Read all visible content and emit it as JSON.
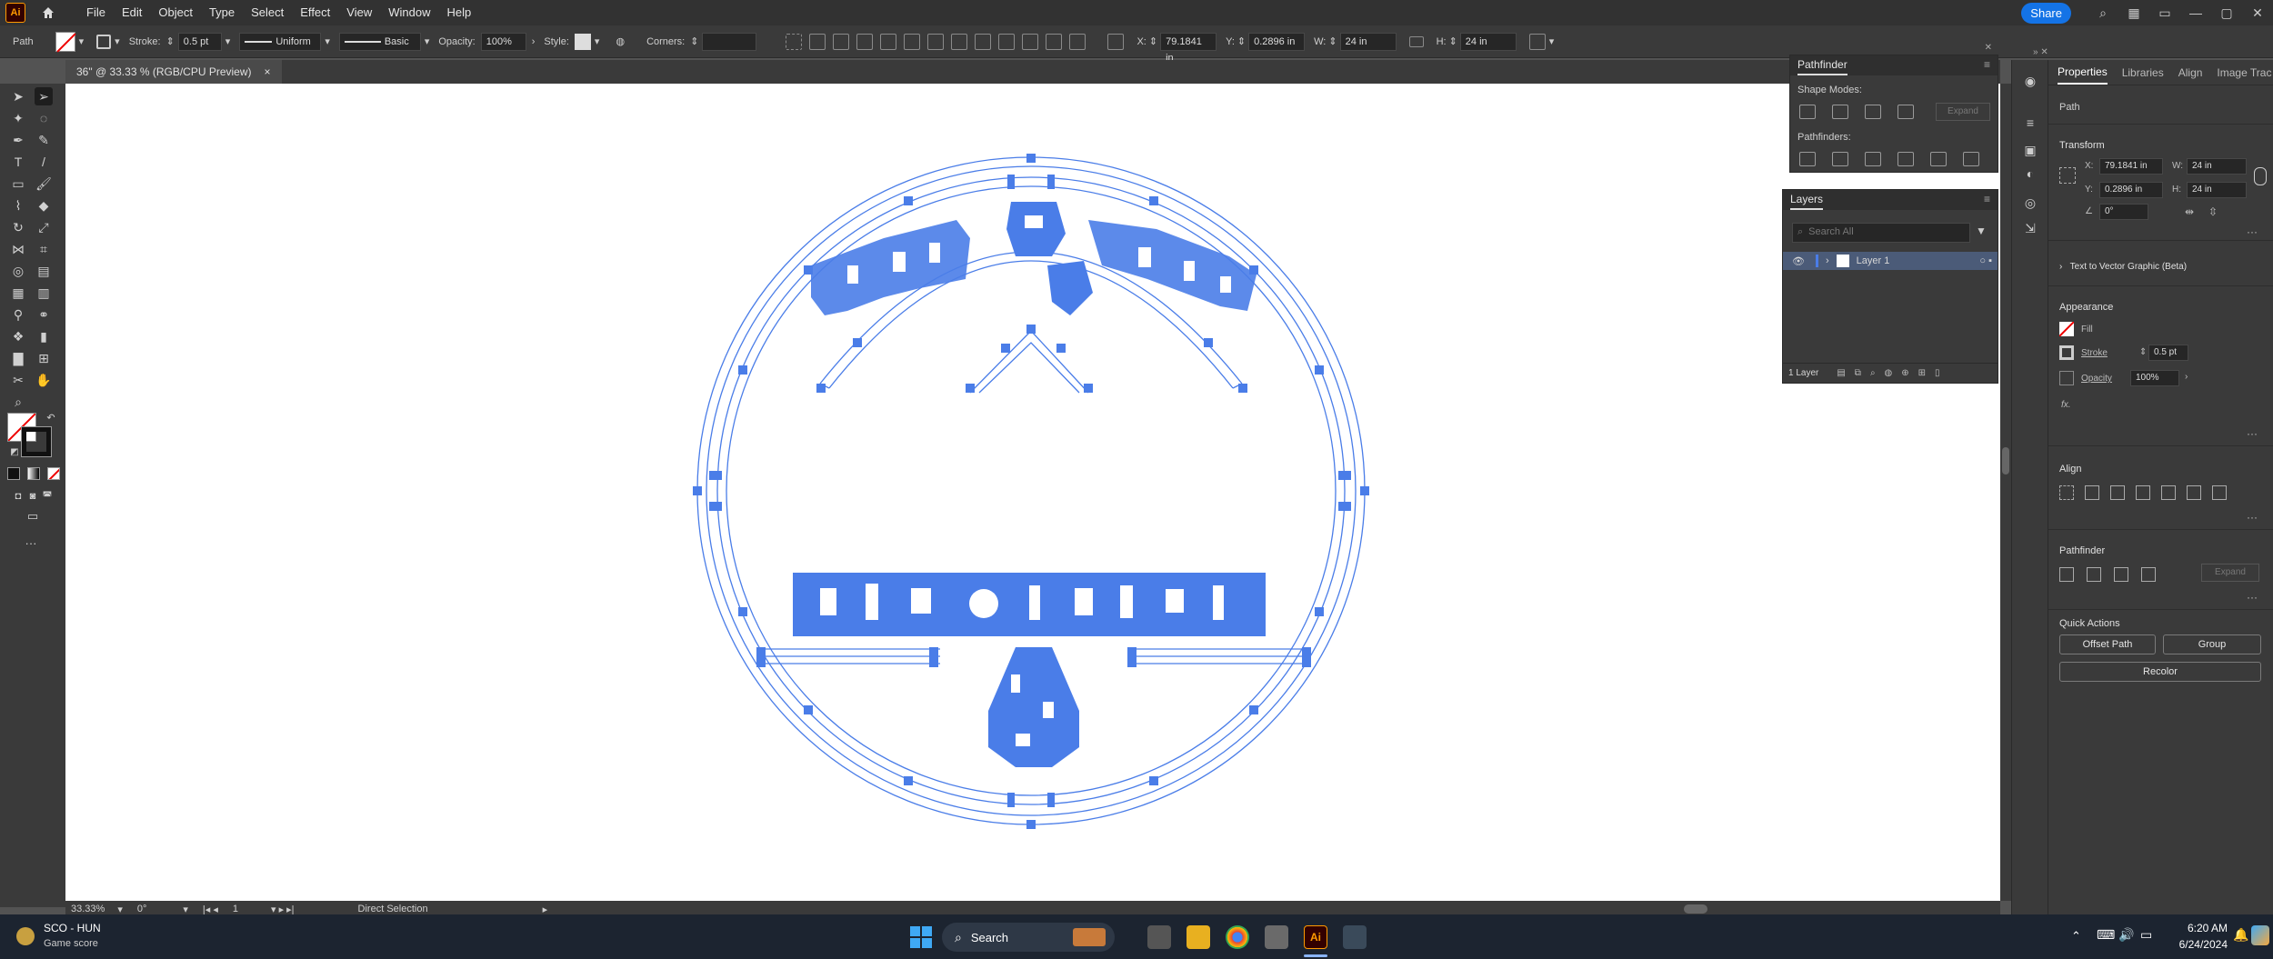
{
  "app": {
    "logo": "Ai",
    "menus": [
      "File",
      "Edit",
      "Object",
      "Type",
      "Select",
      "Effect",
      "View",
      "Window",
      "Help"
    ],
    "share_label": "Share"
  },
  "control_bar": {
    "selection_type": "Path",
    "stroke_label": "Stroke:",
    "stroke_value": "0.5 pt",
    "profile": "Uniform",
    "brush": "Basic",
    "opacity_label": "Opacity:",
    "opacity_value": "100%",
    "style_label": "Style:",
    "corners_label": "Corners:",
    "x_label": "X:",
    "x_value": "79.1841 in",
    "y_label": "Y:",
    "y_value": "0.2896 in",
    "w_label": "W:",
    "w_value": "24 in",
    "h_label": "H:",
    "h_value": "24 in"
  },
  "document_tab": {
    "title": "36\" @ 33.33 % (RGB/CPU Preview)",
    "close": "×"
  },
  "status_bar": {
    "zoom": "33.33%",
    "rotation": "0°",
    "artboard": "1",
    "tool": "Direct Selection"
  },
  "pathfinder_panel": {
    "title": "Pathfinder",
    "shape_modes": "Shape Modes:",
    "expand": "Expand",
    "pathfinders": "Pathfinders:"
  },
  "layers_panel": {
    "title": "Layers",
    "search_placeholder": "Search All",
    "layer_name": "Layer 1",
    "footer": "1 Layer"
  },
  "properties": {
    "tabs": [
      "Properties",
      "Libraries",
      "Align",
      "Image Trac"
    ],
    "object_type": "Path",
    "transform": "Transform",
    "x_label": "X:",
    "x_value": "79.1841 in",
    "y_label": "Y:",
    "y_value": "0.2896 in",
    "w_label": "W:",
    "w_value": "24 in",
    "h_label": "H:",
    "h_value": "24 in",
    "angle": "0°",
    "text_to_vector": "Text to Vector Graphic (Beta)",
    "appearance": "Appearance",
    "fill": "Fill",
    "stroke": "Stroke",
    "stroke_value": "0.5 pt",
    "opacity": "Opacity",
    "opacity_value": "100%",
    "fx": "fx.",
    "align": "Align",
    "pathfinder": "Pathfinder",
    "pathfinder_expand": "Expand",
    "quick_actions": "Quick Actions",
    "offset_path": "Offset Path",
    "group": "Group",
    "recolor": "Recolor"
  },
  "taskbar": {
    "game_title": "SCO - HUN",
    "game_sub": "Game score",
    "search": "Search",
    "time": "6:20 AM",
    "date": "6/24/2024"
  },
  "colors": {
    "accent": "#1473e6",
    "selection": "#4a7de8"
  }
}
